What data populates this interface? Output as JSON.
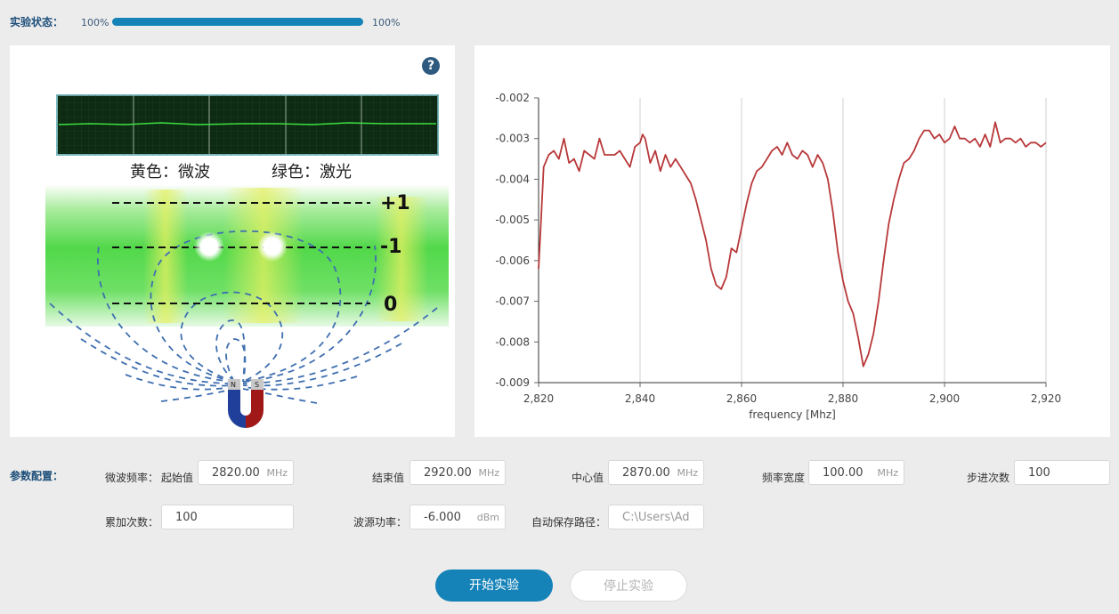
{
  "status": {
    "label": "实验状态：",
    "progress_left": "100%",
    "progress_right": "100%",
    "progress_fraction": 1.0
  },
  "diagram": {
    "help": "?",
    "legend_yellow": "黄色：微波",
    "legend_green": "绿色：激光",
    "levels": [
      "+1",
      "-1",
      "0"
    ],
    "magnet_n": "N",
    "magnet_s": "S"
  },
  "chart_data": {
    "type": "line",
    "xlabel": "frequency [Mhz]",
    "ylabel": "",
    "xlim": [
      2820,
      2920
    ],
    "ylim": [
      -0.009,
      -0.002
    ],
    "x_ticks": [
      "2,820",
      "2,840",
      "2,860",
      "2,880",
      "2,900",
      "2,920"
    ],
    "y_ticks": [
      "-0.002",
      "-0.003",
      "-0.004",
      "-0.005",
      "-0.006",
      "-0.007",
      "-0.008",
      "-0.009"
    ],
    "grid": "vertical",
    "color": "#b8383a",
    "series": [
      {
        "x": [
          2820,
          2820.5,
          2821,
          2822,
          2823,
          2824,
          2825,
          2825.5,
          2826,
          2827,
          2828,
          2829,
          2830,
          2831,
          2832,
          2833,
          2834,
          2835,
          2836,
          2837,
          2838,
          2839,
          2840,
          2840.5,
          2841,
          2842,
          2843,
          2844,
          2845,
          2846,
          2847,
          2848,
          2849,
          2850,
          2851,
          2852,
          2853,
          2854,
          2855,
          2856,
          2857,
          2858,
          2859,
          2860,
          2861,
          2862,
          2863,
          2864,
          2865,
          2866,
          2867,
          2868,
          2869,
          2870,
          2871,
          2872,
          2873,
          2874,
          2875,
          2876,
          2877,
          2878,
          2879,
          2880,
          2881,
          2882,
          2883,
          2884,
          2885,
          2886,
          2887,
          2888,
          2889,
          2890,
          2891,
          2892,
          2893,
          2894,
          2895,
          2896,
          2897,
          2898,
          2899,
          2900,
          2901,
          2902,
          2903,
          2904,
          2905,
          2906,
          2907,
          2908,
          2909,
          2910,
          2911,
          2912,
          2913,
          2914,
          2915,
          2916,
          2917,
          2918,
          2919,
          2920
        ],
        "y": [
          -0.0062,
          -0.005,
          -0.0037,
          -0.0034,
          -0.0033,
          -0.0035,
          -0.003,
          -0.0033,
          -0.0036,
          -0.0035,
          -0.0038,
          -0.0033,
          -0.0034,
          -0.0035,
          -0.003,
          -0.0034,
          -0.0034,
          -0.0034,
          -0.0033,
          -0.0035,
          -0.0037,
          -0.0032,
          -0.0031,
          -0.0029,
          -0.003,
          -0.0036,
          -0.0033,
          -0.0038,
          -0.0034,
          -0.0037,
          -0.0035,
          -0.0037,
          -0.0039,
          -0.0041,
          -0.0045,
          -0.005,
          -0.0055,
          -0.0062,
          -0.0066,
          -0.0067,
          -0.0064,
          -0.0057,
          -0.0058,
          -0.0052,
          -0.0046,
          -0.0041,
          -0.0038,
          -0.0037,
          -0.0035,
          -0.0033,
          -0.0032,
          -0.0034,
          -0.0031,
          -0.0034,
          -0.0035,
          -0.0033,
          -0.0034,
          -0.0037,
          -0.0034,
          -0.0036,
          -0.004,
          -0.0048,
          -0.0058,
          -0.0065,
          -0.007,
          -0.0073,
          -0.0079,
          -0.0086,
          -0.0083,
          -0.0078,
          -0.007,
          -0.006,
          -0.0051,
          -0.0045,
          -0.004,
          -0.0036,
          -0.0035,
          -0.0033,
          -0.003,
          -0.0028,
          -0.0028,
          -0.003,
          -0.0029,
          -0.0031,
          -0.003,
          -0.0027,
          -0.003,
          -0.003,
          -0.0031,
          -0.003,
          -0.0032,
          -0.0029,
          -0.0032,
          -0.0026,
          -0.0031,
          -0.003,
          -0.003,
          -0.0031,
          -0.003,
          -0.0032,
          -0.0031,
          -0.0031,
          -0.0032,
          -0.0031
        ]
      }
    ]
  },
  "config": {
    "section_label": "参数配置：",
    "mw_freq_label": "微波频率：",
    "start_label": "起始值",
    "start_value": "2820.00",
    "end_label": "结束值",
    "end_value": "2920.00",
    "center_label": "中心值",
    "center_value": "2870.00",
    "bandwidth_label": "频率宽度",
    "bandwidth_value": "100.00",
    "freq_unit": "MHz",
    "steps_label": "步进次数",
    "steps_value": "100",
    "accum_label": "累加次数：",
    "accum_value": "100",
    "power_label": "波源功率：",
    "power_value": "-6.000",
    "power_unit": "dBm",
    "path_label": "自动保存路径：",
    "path_value": "C:\\Users\\Ad"
  },
  "buttons": {
    "start": "开始实验",
    "stop": "停止实验"
  }
}
